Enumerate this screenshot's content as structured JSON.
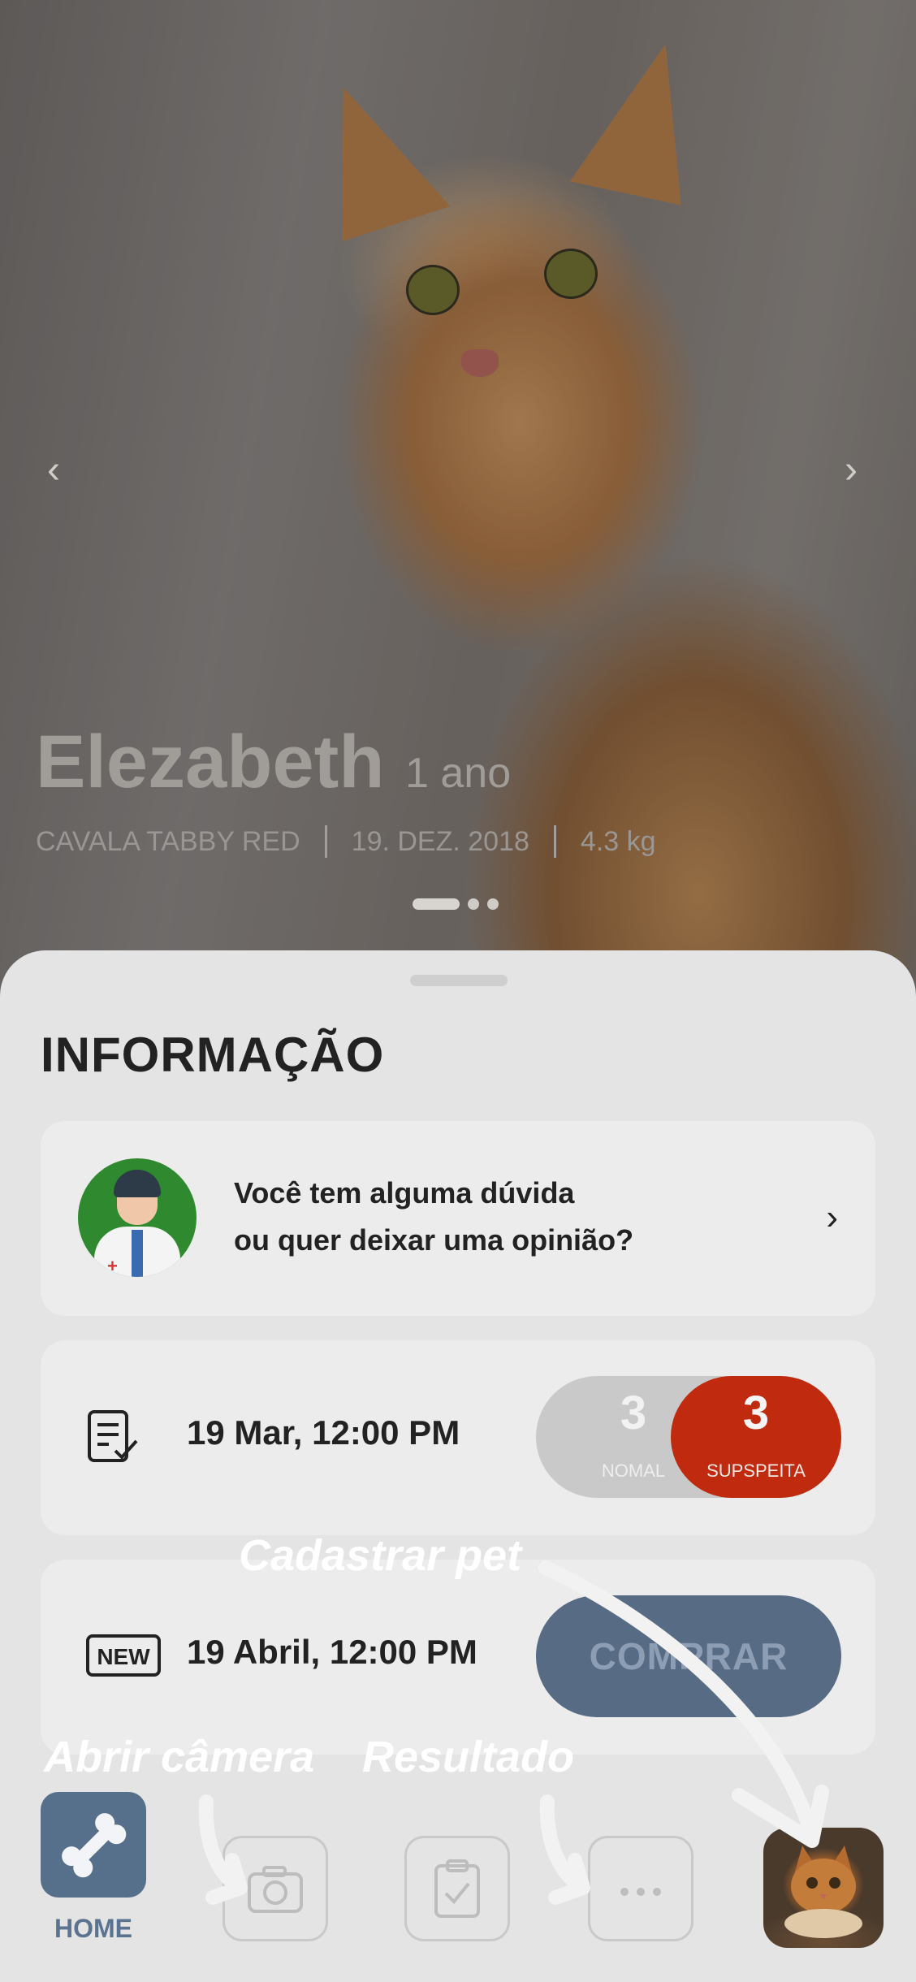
{
  "hero": {
    "pet_name": "Elezabeth",
    "pet_age": "1 ano",
    "breed": "CAVALA TABBY RED",
    "birth_date": "19. DEZ. 2018",
    "weight": "4.3 kg",
    "prev_glyph": "‹",
    "next_glyph": "›",
    "carousel_active_index": 0,
    "carousel_count": 3
  },
  "info": {
    "title": "INFORMAÇÃO",
    "feedback_line1": "Você tem alguma dúvida",
    "feedback_line2": "ou quer deixar uma opinião?",
    "feedback_chevron": "›"
  },
  "records": [
    {
      "date": "19 Mar, 12:00 PM",
      "icon": "document-check-icon",
      "normal_count": "3",
      "normal_label": "NOMAL",
      "suspect_count": "3",
      "suspect_label": "SUPSPEITA"
    },
    {
      "date": "19 Abril, 12:00 PM",
      "icon": "new-badge-icon",
      "badge_text": "NEW",
      "action_label": "COMPRAR"
    }
  ],
  "annotations": {
    "register_pet": "Cadastrar pet",
    "open_camera": "Abrir câmera",
    "result": "Resultado"
  },
  "nav": {
    "home_label": "HOME",
    "home_icon": "bone-icon",
    "camera_icon": "camera-icon",
    "result_icon": "clipboard-check-icon",
    "more_icon": "more-dots-icon",
    "profile_icon": "pet-avatar"
  },
  "colors": {
    "accent": "#566f8a",
    "suspect_red": "#c02b0f",
    "sheet_bg": "#e4e4e4"
  }
}
